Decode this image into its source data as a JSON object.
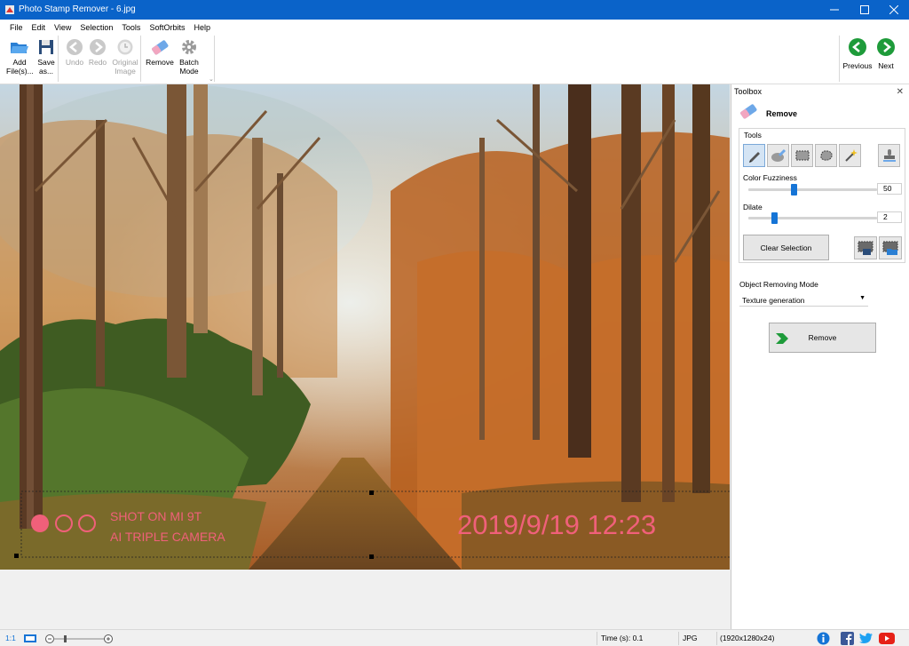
{
  "window": {
    "title": "Photo Stamp Remover - 6.jpg",
    "minimize": "—",
    "maximize": "☐",
    "close": "✕"
  },
  "menu": [
    "File",
    "Edit",
    "View",
    "Selection",
    "Tools",
    "SoftOrbits",
    "Help"
  ],
  "toolbar": {
    "add_files": "Add File(s)...",
    "save_as": "Save as...",
    "undo": "Undo",
    "redo": "Redo",
    "original_image": "Original Image",
    "remove": "Remove",
    "batch_mode": "Batch Mode",
    "previous": "Previous",
    "next": "Next"
  },
  "photo": {
    "stamp_line1": "SHOT ON MI 9T",
    "stamp_line2": "AI TRIPLE CAMERA",
    "date_stamp": "2019/9/19  12:23"
  },
  "toolbox": {
    "header": "Toolbox",
    "close": "✕",
    "section_title": "Remove",
    "tools_label": "Tools",
    "color_fuzziness_label": "Color Fuzziness",
    "color_fuzziness_value": "50",
    "color_fuzziness_level": 0.35,
    "dilate_label": "Dilate",
    "dilate_value": "2",
    "dilate_level": 0.2,
    "clear_selection": "Clear Selection",
    "mode_label": "Object Removing Mode",
    "mode_value": "Texture generation",
    "remove_button": "Remove"
  },
  "status": {
    "zoom_label": "1:1",
    "time": "Time (s): 0.1",
    "format": "JPG",
    "dimensions": "(1920x1280x24)"
  },
  "colors": {
    "titlebar": "#0a63c9",
    "accent": "#1574d6",
    "stamp": "#f0607a",
    "nav_green": "#1e9b3a"
  }
}
